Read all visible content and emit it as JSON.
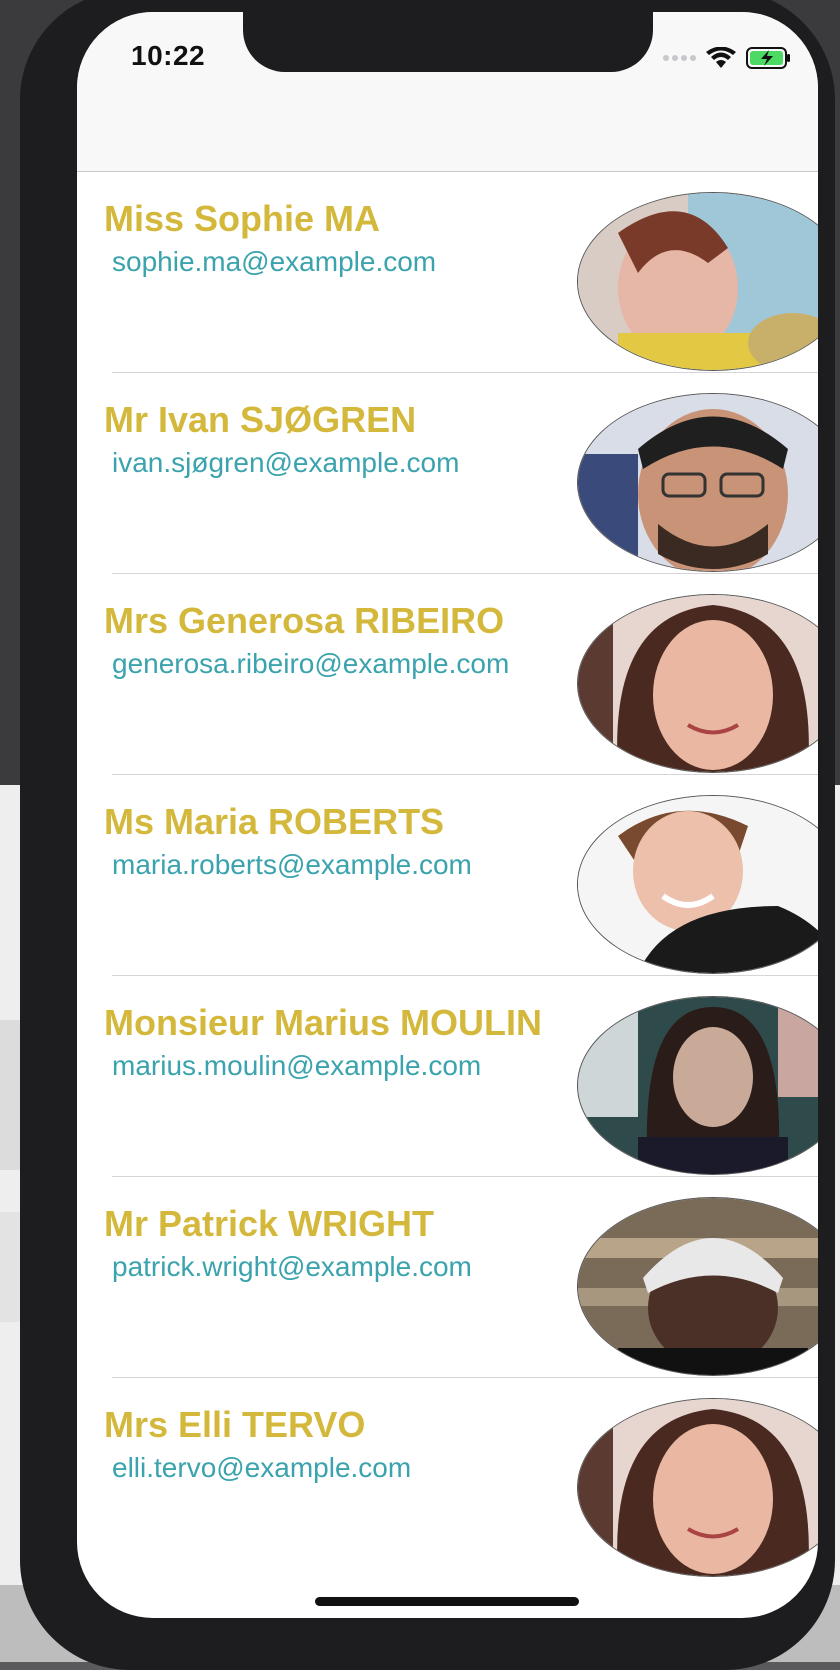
{
  "status_bar": {
    "time": "10:22"
  },
  "contacts": [
    {
      "name": "Miss Sophie MA",
      "email": "sophie.ma@example.com"
    },
    {
      "name": "Mr Ivan SJØGREN",
      "email": "ivan.sjøgren@example.com"
    },
    {
      "name": "Mrs Generosa RIBEIRO",
      "email": "generosa.ribeiro@example.com"
    },
    {
      "name": "Ms Maria ROBERTS",
      "email": "maria.roberts@example.com"
    },
    {
      "name": "Monsieur Marius MOULIN",
      "email": "marius.moulin@example.com"
    },
    {
      "name": "Mr Patrick WRIGHT",
      "email": "patrick.wright@example.com"
    },
    {
      "name": "Mrs Elli TERVO",
      "email": "elli.tervo@example.com"
    }
  ],
  "colors": {
    "name_text": "#d4b83c",
    "email_text": "#3aa3ad",
    "battery": "#4cd964"
  },
  "icons": [
    "cellular-signal-icon",
    "wifi-icon",
    "battery-charging-icon"
  ]
}
